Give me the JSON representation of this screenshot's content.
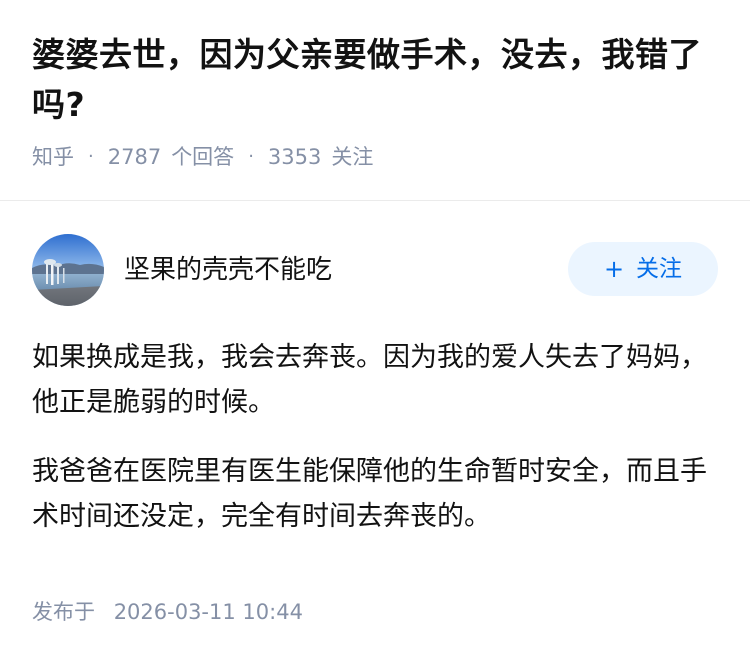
{
  "question": {
    "title": "婆婆去世，因为父亲要做手术，没去，我错了吗?",
    "source": "知乎",
    "answer_count": "2787",
    "answer_label": "个回答",
    "follow_count": "3353",
    "follow_label": "关注"
  },
  "answer": {
    "author": {
      "name": "坚果的壳壳不能吃",
      "avatar_icon": "avatar-lake-photo"
    },
    "follow_button": {
      "plus": "+",
      "label": "关注"
    },
    "paragraphs": [
      "如果换成是我，我会去奔丧。因为我的爱人失去了妈妈，他正是脆弱的时候。",
      "我爸爸在医院里有医生能保障他的生命暂时安全，而且手术时间还没定，完全有时间去奔丧的。"
    ],
    "publish": {
      "label": "发布于",
      "time": "2026-03-11 10:44"
    }
  },
  "colors": {
    "accent": "#056de8",
    "follow_bg": "#ebf5ff",
    "meta_gray": "#8590a6",
    "text": "#121212"
  }
}
